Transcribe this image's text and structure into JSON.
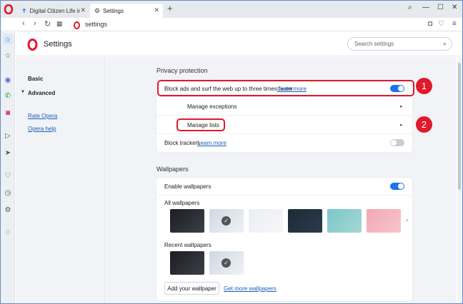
{
  "tabs": [
    {
      "label": "Digital Citizen Life in a digi"
    },
    {
      "label": "Settings"
    }
  ],
  "address": {
    "url": "settings"
  },
  "settings_title": "Settings",
  "search": {
    "placeholder": "Search settings"
  },
  "left_nav": {
    "basic": "Basic",
    "advanced": "Advanced",
    "rate": "Rate Opera",
    "help": "Opera help"
  },
  "privacy": {
    "heading": "Privacy protection",
    "block_ads": "Block ads and surf the web up to three times faster",
    "learn_more": "Learn more",
    "block_ads_on": true,
    "manage_exceptions": "Manage exceptions",
    "manage_lists": "Manage lists",
    "block_trackers": "Block trackers",
    "trackers_learn_more": "Learn more",
    "block_trackers_on": false
  },
  "wallpapers": {
    "heading": "Wallpapers",
    "enable": "Enable wallpapers",
    "enable_on": true,
    "all": "All wallpapers",
    "recent": "Recent wallpapers",
    "add": "Add your wallpaper",
    "get_more": "Get more wallpapers"
  },
  "callouts": [
    "1",
    "2"
  ],
  "colors": {
    "accent": "#1a73e8",
    "callout": "#e0192b",
    "opera_red": "#e0192b"
  }
}
